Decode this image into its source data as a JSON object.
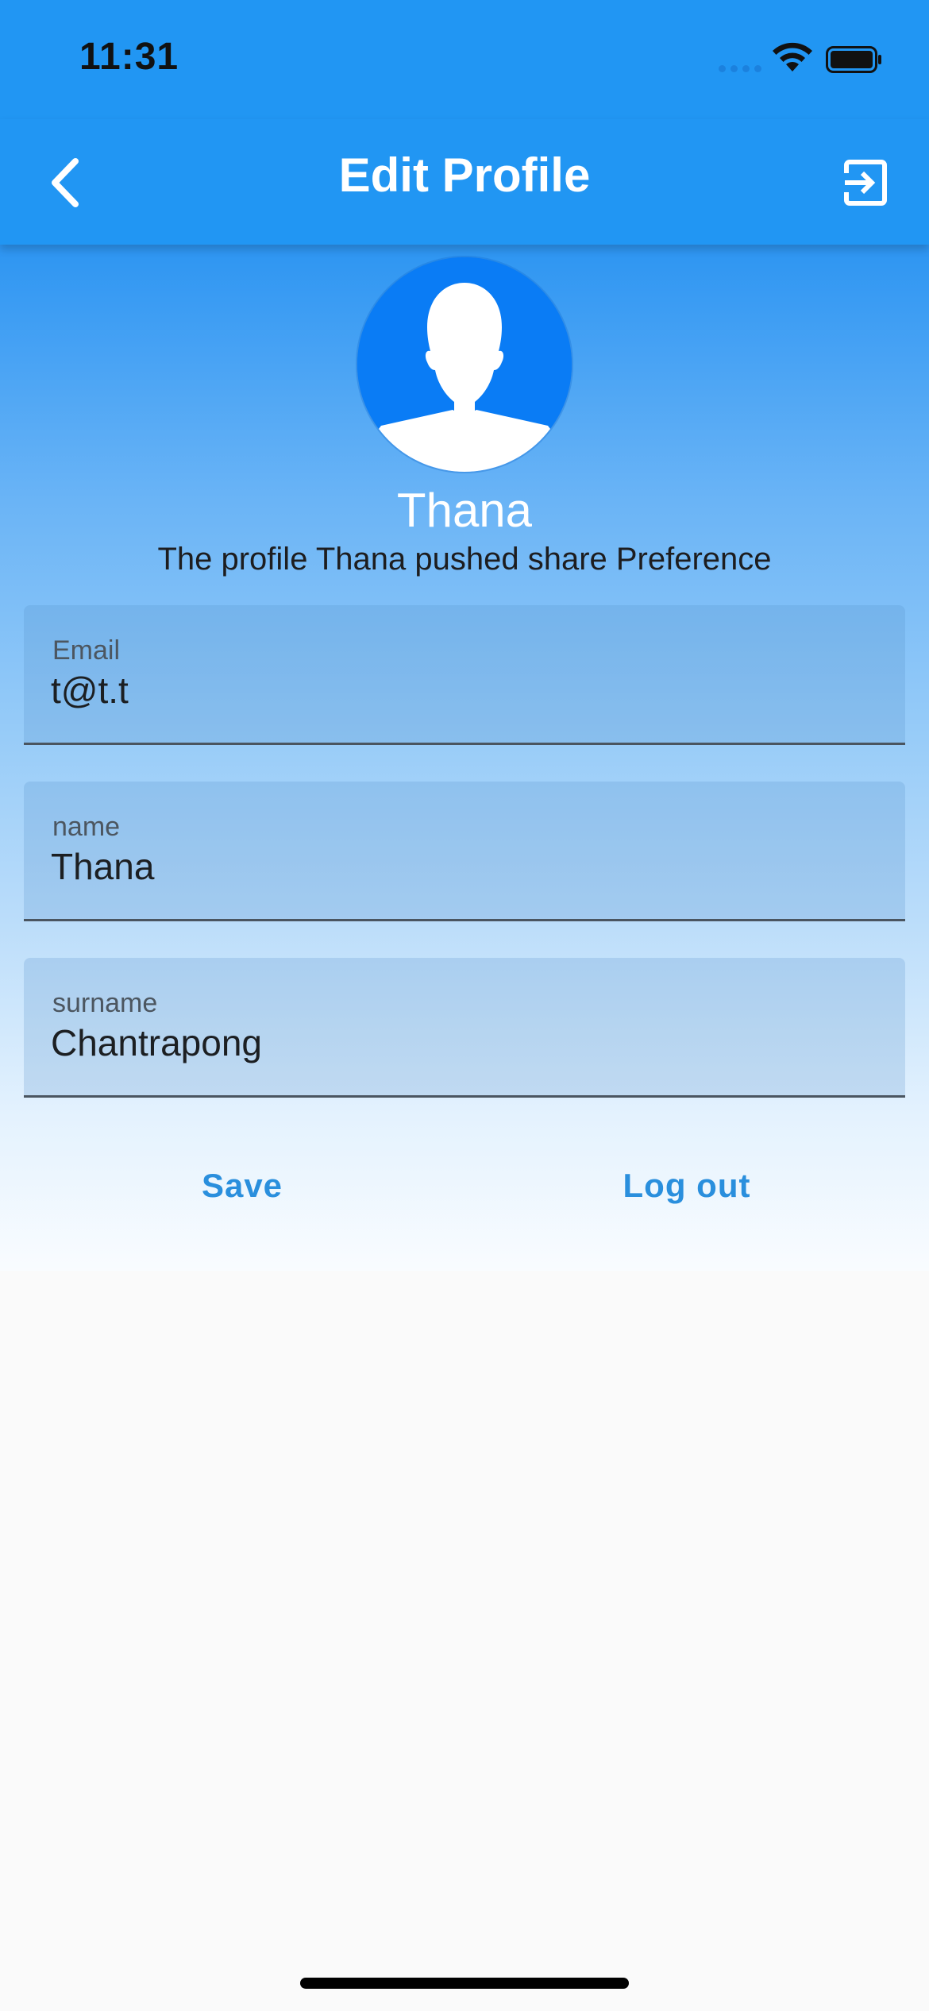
{
  "status_bar": {
    "time": "11:31"
  },
  "app_bar": {
    "title": "Edit Profile",
    "back_icon": "chevron-left-icon",
    "action_icon": "exit-to-app-icon",
    "color": "#2196f3"
  },
  "profile": {
    "avatar_icon": "person-silhouette-icon",
    "name": "Thana",
    "subtitle": "The profile Thana pushed share Preference"
  },
  "form": {
    "email": {
      "label": "Email",
      "value": "t@t.t"
    },
    "name": {
      "label": "name",
      "value": "Thana"
    },
    "surname": {
      "label": "surname",
      "value": "Chantrapong"
    }
  },
  "actions": {
    "save_label": "Save",
    "logout_label": "Log out",
    "accent_color": "#2a8fdd"
  }
}
